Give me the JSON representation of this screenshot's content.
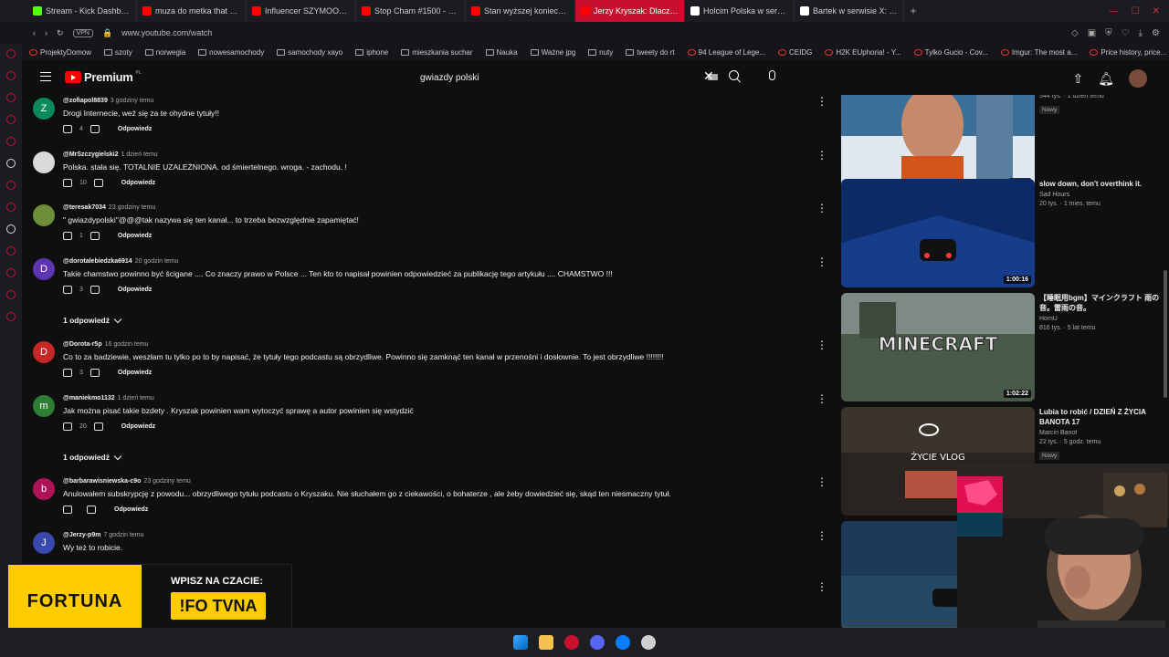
{
  "browser": {
    "tabs": [
      {
        "label": "Stream - Kick Dashboard",
        "color": "#53fc18",
        "active": false
      },
      {
        "label": "muza do metka that keeps",
        "color": "#ff0000",
        "active": false
      },
      {
        "label": "Influencer SZYMOOL ujaw",
        "color": "#ff0000",
        "active": false
      },
      {
        "label": "Stop Cham #1500 - Niebe",
        "color": "#ff0000",
        "active": false
      },
      {
        "label": "Stan wyższej konieczność",
        "color": "#ff0000",
        "active": false
      },
      {
        "label": "Jerzy Kryszak: Dlaczego p",
        "color": "#ff0000",
        "active": true
      },
      {
        "label": "Holcim Polska w serwisie",
        "color": "#ffffff",
        "active": false
      },
      {
        "label": "Bartek w serwisie X: „O TA",
        "color": "#ffffff",
        "active": false
      }
    ],
    "url": "www.youtube.com/watch",
    "vpn_label": "VPN",
    "bookmarks": [
      {
        "label": "ProjektyDomow",
        "icon": "yt-icon"
      },
      {
        "label": "szoty",
        "icon": "folder-icon"
      },
      {
        "label": "norwegia",
        "icon": "folder-icon"
      },
      {
        "label": "nowesamochody",
        "icon": "folder-icon"
      },
      {
        "label": "samochody xayo",
        "icon": "folder-icon"
      },
      {
        "label": "iphone",
        "icon": "folder-icon"
      },
      {
        "label": "mieszkania suchar",
        "icon": "folder-icon"
      },
      {
        "label": "Nauka",
        "icon": "folder-icon"
      },
      {
        "label": "Ważne jpg",
        "icon": "folder-icon"
      },
      {
        "label": "nuty",
        "icon": "folder-icon"
      },
      {
        "label": "tweety do rt",
        "icon": "folder-icon"
      },
      {
        "label": "94 League of Lege...",
        "icon": "site-icon"
      },
      {
        "label": "CEIDG",
        "icon": "site-icon"
      },
      {
        "label": "H2K EUphoria! - Y...",
        "icon": "site-icon"
      },
      {
        "label": "Tylko Gucio - Cov...",
        "icon": "site-icon"
      },
      {
        "label": "Imgur: The most a...",
        "icon": "site-icon"
      },
      {
        "label": "Price history, price...",
        "icon": "site-icon"
      }
    ]
  },
  "youtube": {
    "logo_text": "Premium",
    "logo_region": "PL",
    "search_query": "gwiazdy polski"
  },
  "comments": [
    {
      "avatar_letter": "Z",
      "avatar_color": "#0d8a5a",
      "user": "@zofiapol8839",
      "time": "3 godziny temu",
      "text": "Drogi Internecie, weź się za te ohydne tytuły!!",
      "likes": "4",
      "reply_label": "Odpowiedz"
    },
    {
      "avatar_letter": "",
      "avatar_color": "#d9d9d9",
      "user": "@MrSzczygielski2",
      "time": "1 dzień temu",
      "text": "Polska. stała się. TOTALNIE  UZALEŻNIONA. od  śmiertelnego. wroga. -  zachodu. !",
      "likes": "10",
      "reply_label": "Odpowiedz"
    },
    {
      "avatar_letter": "",
      "avatar_color": "#6e8f3a",
      "user": "@teresak7034",
      "time": "23 godziny temu",
      "text": "\" gwiazdypolski\"@@@tak nazywa się ten kanał... to trzeba bezwzględnie zapamiętać!",
      "likes": "1",
      "reply_label": "Odpowiedz"
    },
    {
      "avatar_letter": "D",
      "avatar_color": "#5e35b1",
      "user": "@dorotalebiedzka6914",
      "time": "20 godzin temu",
      "text": "Takie chamstwo powinno być ścigane .... Co znaczy prawo w Polsce ... Ten kto to napisał powinien odpowiedzieć za publikację tego artykułu .... CHAMSTWO  !!!",
      "likes": "3",
      "reply_label": "Odpowiedz"
    },
    {
      "avatar_letter": "D",
      "avatar_color": "#c62828",
      "user": "@Dorota-r5p",
      "time": "16 godzin temu",
      "text": "Co to za badziewie, weszłam tu tylko po to by napisać, że tytuły tego podcastu są obrzydliwe. Powinno się zamknąć ten kanał w przenośni i dosłownie. To jest obrzydliwe !!!!!!!!",
      "likes": "3",
      "reply_label": "Odpowiedz"
    },
    {
      "avatar_letter": "m",
      "avatar_color": "#2e7d32",
      "user": "@maniekmo1132",
      "time": "1 dzień temu",
      "text": "Jak można pisać takie bzdety . Kryszak powinien wam wytoczyć sprawę a autor powinien się wstydzić",
      "likes": "20",
      "reply_label": "Odpowiedz"
    },
    {
      "avatar_letter": "b",
      "avatar_color": "#ad1457",
      "user": "@barbarawisniewska-c9o",
      "time": "23 godziny temu",
      "text": "Anulowałem subskrypcję z powodu... obrzydliwego tytułu podcastu o Kryszaku. Nie słuchałem go z ciekawości, o bohaterze , ale żeby dowiedzieć się, skąd ten niesmaczny tytuł.",
      "likes": "",
      "reply_label": "Odpowiedz"
    },
    {
      "avatar_letter": "J",
      "avatar_color": "#3949ab",
      "user": "@Jerzy-p9m",
      "time": "7 godzin temu",
      "text": "Wy też to robicie.",
      "likes": "",
      "reply_label": ""
    }
  ],
  "reply_toggles": [
    {
      "label": "1 odpowiedź"
    },
    {
      "label": "1 odpowiedź"
    }
  ],
  "recommendations": [
    {
      "title": "",
      "channel": "PatecWalatec",
      "meta": "544 tys. · 1 dzień temu",
      "badge": "Nowy",
      "duration": "42:01",
      "thumb_color": "#3b6f9a"
    },
    {
      "title": "slow down, don't overthink it.",
      "channel": "Sad Hours",
      "meta": "20 tys. · 1 mies. temu",
      "badge": "",
      "duration": "1:00:16",
      "thumb_color": "#0c2a66"
    },
    {
      "title": "【睡眠用bgm】マインクラフト 雨の音。雷雨の音。",
      "channel": "HomU",
      "meta": "816 tys. · 5 lat temu",
      "badge": "",
      "duration": "1:02:22",
      "thumb_color": "#4a5a4a"
    },
    {
      "title": "Lubia to robić / DZIEŃ Z ŻYCIA BANOTA 17",
      "channel": "Marcin Banot",
      "meta": "22 tys. · 5 godz. temu",
      "badge": "Nowy",
      "duration": "",
      "thumb_color": "#2a2420"
    },
    {
      "title": "",
      "channel": "",
      "meta": "",
      "badge": "",
      "duration": "",
      "thumb_color": "#1d3a5a"
    }
  ],
  "thumb_overlays": {
    "minecraft": "MINECRAFT",
    "vlog": "ŻYCIE   VLOG"
  },
  "ad": {
    "brand": "FORTUNA",
    "cta": "WPISZ NA CZACIE:",
    "code": "!FO TVNA"
  },
  "colors": {
    "accent": "#ff0000",
    "background": "#0f0f0f",
    "ad_yellow": "#ffcc00"
  }
}
